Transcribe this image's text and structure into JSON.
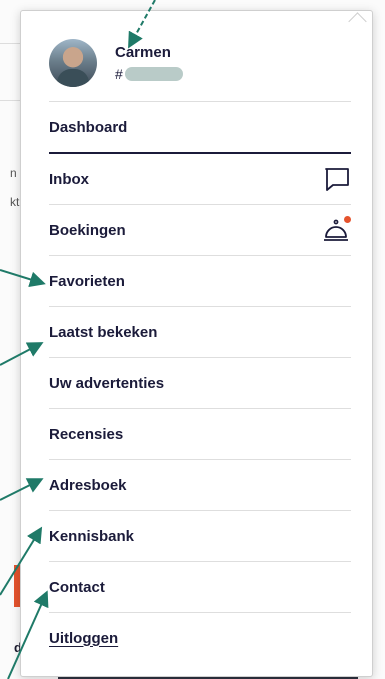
{
  "user": {
    "name": "Carmen",
    "member_prefix": "#"
  },
  "menu": {
    "items": [
      {
        "label": "Dashboard"
      },
      {
        "label": "Inbox",
        "icon": "chat-bubble-icon"
      },
      {
        "label": "Boekingen",
        "icon": "service-bell-icon",
        "notification": true
      },
      {
        "label": "Favorieten"
      },
      {
        "label": "Laatst bekeken"
      },
      {
        "label": "Uw advertenties"
      },
      {
        "label": "Recensies"
      },
      {
        "label": "Adresboek"
      },
      {
        "label": "Kennisbank"
      },
      {
        "label": "Contact"
      }
    ],
    "logout_label": "Uitloggen"
  },
  "background": {
    "letters": [
      "n",
      "kt"
    ]
  },
  "colors": {
    "text": "#1b1b3a",
    "accent": "#e5532d",
    "annotation": "#1f7a68",
    "masked": "#b9cbc8"
  }
}
